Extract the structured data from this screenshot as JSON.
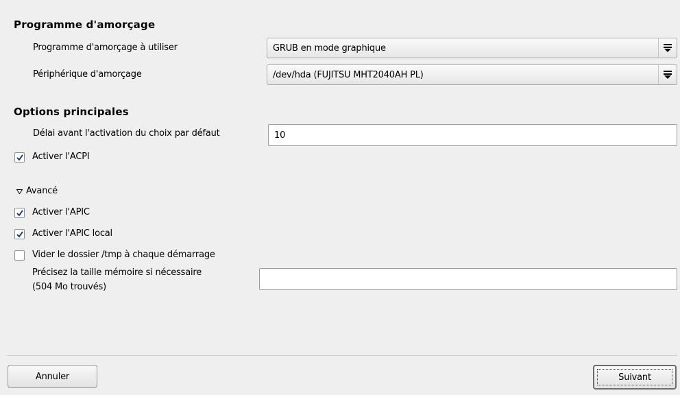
{
  "bootloader_section": {
    "title": "Programme d'amorçage",
    "bootloader_label": "Programme d'amorçage à utiliser",
    "bootloader_value": "GRUB en mode graphique",
    "boot_device_label": "Périphérique d'amorçage",
    "boot_device_value": "/dev/hda (FUJITSU MHT2040AH PL)"
  },
  "main_options": {
    "title": "Options principales",
    "delay_label": "Délai avant l'activation du choix par défaut",
    "delay_value": "10",
    "acpi_label": "Activer l'ACPI",
    "acpi_checked": true
  },
  "advanced": {
    "toggle_label": "Avancé",
    "expanded": true,
    "apic_label": "Activer l'APIC",
    "apic_checked": true,
    "local_apic_label": "Activer l'APIC local",
    "local_apic_checked": true,
    "clean_tmp_label": "Vider le dossier /tmp à chaque démarrage",
    "clean_tmp_checked": false,
    "memory_label_line1": "Précisez la taille mémoire si nécessaire",
    "memory_label_line2": "(504 Mo trouvés)",
    "memory_value": ""
  },
  "footer": {
    "cancel_label": "Annuler",
    "next_label": "Suivant"
  }
}
